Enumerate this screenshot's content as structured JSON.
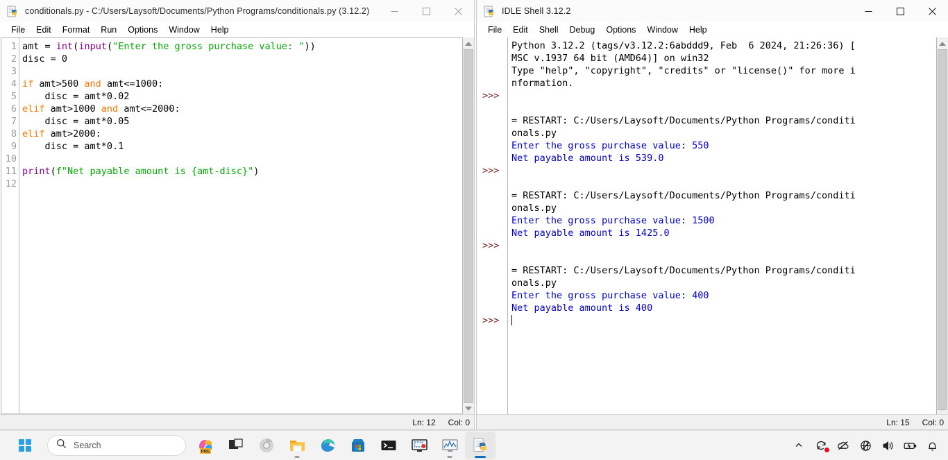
{
  "editor_window": {
    "title": "conditionals.py - C:/Users/Laysoft/Documents/Python Programs/conditionals.py (3.12.2)",
    "icon": "python-file-icon",
    "menus": [
      "File",
      "Edit",
      "Format",
      "Run",
      "Options",
      "Window",
      "Help"
    ],
    "caption": {
      "minimize": "minimize-icon",
      "maximize": "maximize-icon",
      "close": "close-icon"
    },
    "line_numbers": [
      "1",
      "2",
      "3",
      "4",
      "5",
      "6",
      "7",
      "8",
      "9",
      "10",
      "11",
      "12"
    ],
    "code_lines": [
      [
        {
          "t": "amt = ",
          "c": "plain"
        },
        {
          "t": "int",
          "c": "bi"
        },
        {
          "t": "(",
          "c": "plain"
        },
        {
          "t": "input",
          "c": "bi"
        },
        {
          "t": "(",
          "c": "plain"
        },
        {
          "t": "\"Enter the gross purchase value: \"",
          "c": "str"
        },
        {
          "t": "))",
          "c": "plain"
        }
      ],
      [
        {
          "t": "disc = 0",
          "c": "plain"
        }
      ],
      [
        {
          "t": "",
          "c": "plain"
        }
      ],
      [
        {
          "t": "if",
          "c": "kw"
        },
        {
          "t": " amt>500 ",
          "c": "plain"
        },
        {
          "t": "and",
          "c": "kw"
        },
        {
          "t": " amt<=1000:",
          "c": "plain"
        }
      ],
      [
        {
          "t": "    disc = amt*0.02",
          "c": "plain"
        }
      ],
      [
        {
          "t": "elif",
          "c": "kw"
        },
        {
          "t": " amt>1000 ",
          "c": "plain"
        },
        {
          "t": "and",
          "c": "kw"
        },
        {
          "t": " amt<=2000:",
          "c": "plain"
        }
      ],
      [
        {
          "t": "    disc = amt*0.05",
          "c": "plain"
        }
      ],
      [
        {
          "t": "elif",
          "c": "kw"
        },
        {
          "t": " amt>2000:",
          "c": "plain"
        }
      ],
      [
        {
          "t": "    disc = amt*0.1",
          "c": "plain"
        }
      ],
      [
        {
          "t": "",
          "c": "plain"
        }
      ],
      [
        {
          "t": "print",
          "c": "bi"
        },
        {
          "t": "(",
          "c": "plain"
        },
        {
          "t": "f\"Net payable amount is {amt-disc}\"",
          "c": "str"
        },
        {
          "t": ")",
          "c": "plain"
        }
      ],
      [
        {
          "t": "",
          "c": "plain"
        }
      ]
    ],
    "status": {
      "line": "Ln: 12",
      "col": "Col: 0"
    }
  },
  "shell_window": {
    "title": "IDLE Shell 3.12.2",
    "icon": "python-shell-icon",
    "menus": [
      "File",
      "Edit",
      "Shell",
      "Debug",
      "Options",
      "Window",
      "Help"
    ],
    "caption": {
      "minimize": "minimize-icon",
      "maximize": "maximize-icon",
      "close": "close-icon"
    },
    "prompt_symbol": ">>>",
    "lines": [
      {
        "prompt": "",
        "text": "Python 3.12.2 (tags/v3.12.2:6abddd9, Feb  6 2024, 21:26:36) [",
        "color": "black"
      },
      {
        "prompt": "",
        "text": "MSC v.1937 64 bit (AMD64)] on win32",
        "color": "black"
      },
      {
        "prompt": "",
        "text": "Type \"help\", \"copyright\", \"credits\" or \"license()\" for more i",
        "color": "black"
      },
      {
        "prompt": "",
        "text": "nformation.",
        "color": "black"
      },
      {
        "prompt": ">>>",
        "text": "",
        "color": "black"
      },
      {
        "prompt": "",
        "text": "",
        "color": "black"
      },
      {
        "prompt": "",
        "text": "= RESTART: C:/Users/Laysoft/Documents/Python Programs/conditi",
        "color": "black"
      },
      {
        "prompt": "",
        "text": "onals.py",
        "color": "black"
      },
      {
        "prompt": "",
        "text": "Enter the gross purchase value: 550",
        "color": "blue"
      },
      {
        "prompt": "",
        "text": "Net payable amount is 539.0",
        "color": "blue"
      },
      {
        "prompt": ">>>",
        "text": "",
        "color": "black"
      },
      {
        "prompt": "",
        "text": "",
        "color": "black"
      },
      {
        "prompt": "",
        "text": "= RESTART: C:/Users/Laysoft/Documents/Python Programs/conditi",
        "color": "black"
      },
      {
        "prompt": "",
        "text": "onals.py",
        "color": "black"
      },
      {
        "prompt": "",
        "text": "Enter the gross purchase value: 1500",
        "color": "blue"
      },
      {
        "prompt": "",
        "text": "Net payable amount is 1425.0",
        "color": "blue"
      },
      {
        "prompt": ">>>",
        "text": "",
        "color": "black"
      },
      {
        "prompt": "",
        "text": "",
        "color": "black"
      },
      {
        "prompt": "",
        "text": "= RESTART: C:/Users/Laysoft/Documents/Python Programs/conditi",
        "color": "black"
      },
      {
        "prompt": "",
        "text": "onals.py",
        "color": "black"
      },
      {
        "prompt": "",
        "text": "Enter the gross purchase value: 400",
        "color": "blue"
      },
      {
        "prompt": "",
        "text": "Net payable amount is 400",
        "color": "blue"
      },
      {
        "prompt": ">>>",
        "text": "",
        "color": "black",
        "cursor": true
      }
    ],
    "status": {
      "line": "Ln: 15",
      "col": "Col: 0"
    }
  },
  "taskbar": {
    "start_label": "start-button",
    "search": {
      "placeholder": "Search",
      "icon": "search-icon"
    },
    "apps": [
      {
        "name": "copilot-m365-icon",
        "badge": "PRE",
        "running": false
      },
      {
        "name": "task-view-icon",
        "running": false
      },
      {
        "name": "chrome-icon",
        "running": false
      },
      {
        "name": "file-explorer-icon",
        "running": true
      },
      {
        "name": "edge-icon",
        "running": false
      },
      {
        "name": "microsoft-store-icon",
        "running": false
      },
      {
        "name": "terminal-icon",
        "running": false
      },
      {
        "name": "snipping-tool-icon",
        "running": false
      },
      {
        "name": "task-manager-icon",
        "running": true
      },
      {
        "name": "python-idle-icon",
        "running": true,
        "active": true
      }
    ],
    "tray": [
      {
        "name": "show-hidden-icons-chevron-icon"
      },
      {
        "name": "windows-update-icon",
        "badge_color": "#e81123"
      },
      {
        "name": "onedrive-offline-icon"
      },
      {
        "name": "network-disconnected-icon"
      },
      {
        "name": "volume-icon"
      },
      {
        "name": "battery-charging-icon"
      },
      {
        "name": "notifications-bell-icon"
      }
    ]
  },
  "colors": {
    "keyword": "#ff7700",
    "builtin": "#900090",
    "string": "#00aa00",
    "shell_output": "#0000cc",
    "prompt": "#772222",
    "taskbar_bg": "#f3f3f3",
    "accent": "#0d6ec4"
  }
}
